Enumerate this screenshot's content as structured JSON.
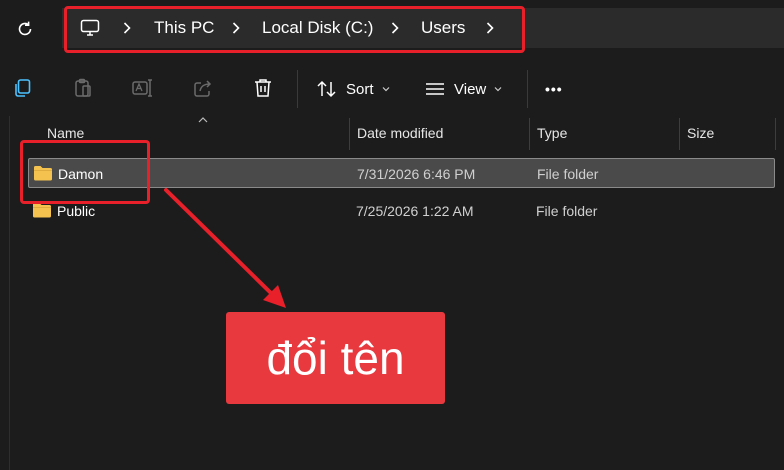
{
  "address_bar": {
    "breadcrumbs": [
      "This PC",
      "Local Disk (C:)",
      "Users"
    ],
    "refresh_icon": "refresh-icon",
    "root_icon": "monitor-icon"
  },
  "toolbar": {
    "icons": [
      "copy-icon",
      "paste-icon",
      "rename-icon",
      "share-icon",
      "delete-icon"
    ],
    "sort_label": "Sort",
    "view_label": "View",
    "more_label": "•••"
  },
  "columns": {
    "name": "Name",
    "date_modified": "Date modified",
    "type": "Type",
    "size": "Size"
  },
  "files": [
    {
      "name": "Damon",
      "date_modified": "7/31/2026 6:46 PM",
      "type": "File folder",
      "selected": true
    },
    {
      "name": "Public",
      "date_modified": "7/25/2026 1:22 AM",
      "type": "File folder",
      "selected": false
    }
  ],
  "annotation": {
    "callout_text": "đổi tên",
    "highlight_color": "#e8202a",
    "callout_color": "#e8393f"
  },
  "colors": {
    "background": "#1c1c1c",
    "address_bg": "#2b2b2b",
    "selected_row": "#4a4a4a",
    "folder": "#f3c24f"
  }
}
